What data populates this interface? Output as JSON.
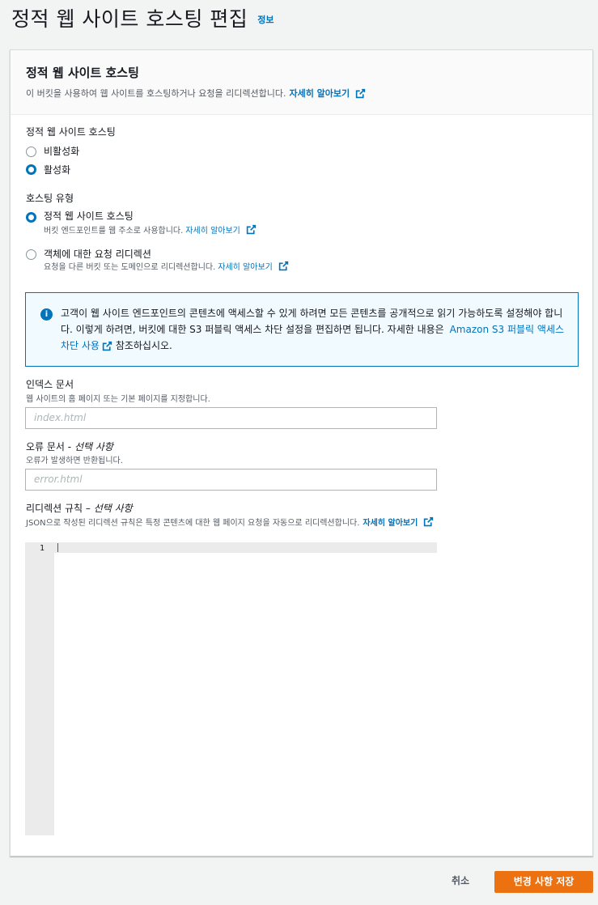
{
  "header": {
    "title": "정적 웹 사이트 호스팅 편집",
    "info": "정보"
  },
  "panel": {
    "title": "정적 웹 사이트 호스팅",
    "description": "이 버킷을 사용하여 웹 사이트를 호스팅하거나 요청을 리디렉션합니다.",
    "learn_more": "자세히 알아보기"
  },
  "static_hosting": {
    "label": "정적 웹 사이트 호스팅",
    "options": [
      {
        "label": "비활성화",
        "checked": false
      },
      {
        "label": "활성화",
        "checked": true
      }
    ]
  },
  "hosting_type": {
    "label": "호스팅 유형",
    "options": [
      {
        "label": "정적 웹 사이트 호스팅",
        "desc": "버킷 엔드포인트를 웹 주소로 사용합니다.",
        "link": "자세히 알아보기",
        "checked": true
      },
      {
        "label": "객체에 대한 요청 리디렉션",
        "desc": "요청을 다른 버킷 또는 도메인으로 리디렉션합니다.",
        "link": "자세히 알아보기",
        "checked": false
      }
    ]
  },
  "alert": {
    "text": "고객이 웹 사이트 엔드포인트의 콘텐츠에 액세스할 수 있게 하려면 모든 콘텐츠를 공개적으로 읽기 가능하도록 설정해야 합니다. 이렇게 하려면, 버킷에 대한 S3 퍼블릭 액세스 차단 설정을 편집하면 됩니다. 자세한 내용은",
    "link": "Amazon S3 퍼블릭 액세스 차단 사용",
    "suffix": "참조하십시오."
  },
  "index_doc": {
    "label": "인덱스 문서",
    "desc": "웹 사이트의 홈 페이지 또는 기본 페이지를 지정합니다.",
    "placeholder": "index.html"
  },
  "error_doc": {
    "label": "오류 문서 - ",
    "optional": "선택 사항",
    "desc": "오류가 발생하면 반환됩니다.",
    "placeholder": "error.html"
  },
  "redirect_rules": {
    "label": "리디렉션 규칙 – ",
    "optional": "선택 사항",
    "desc": "JSON으로 작성된 리디렉션 규칙은 특정 콘텐츠에 대한 웹 페이지 요청을 자동으로 리디렉션합니다.",
    "link": "자세히 알아보기",
    "line_number": "1"
  },
  "footer": {
    "cancel": "취소",
    "save": "변경 사항 저장"
  },
  "colors": {
    "link": "#0073bb",
    "primary_button": "#ec7211",
    "alert_bg": "#f1faff"
  },
  "icons": {
    "external": "external-link-icon",
    "info": "info-icon"
  }
}
